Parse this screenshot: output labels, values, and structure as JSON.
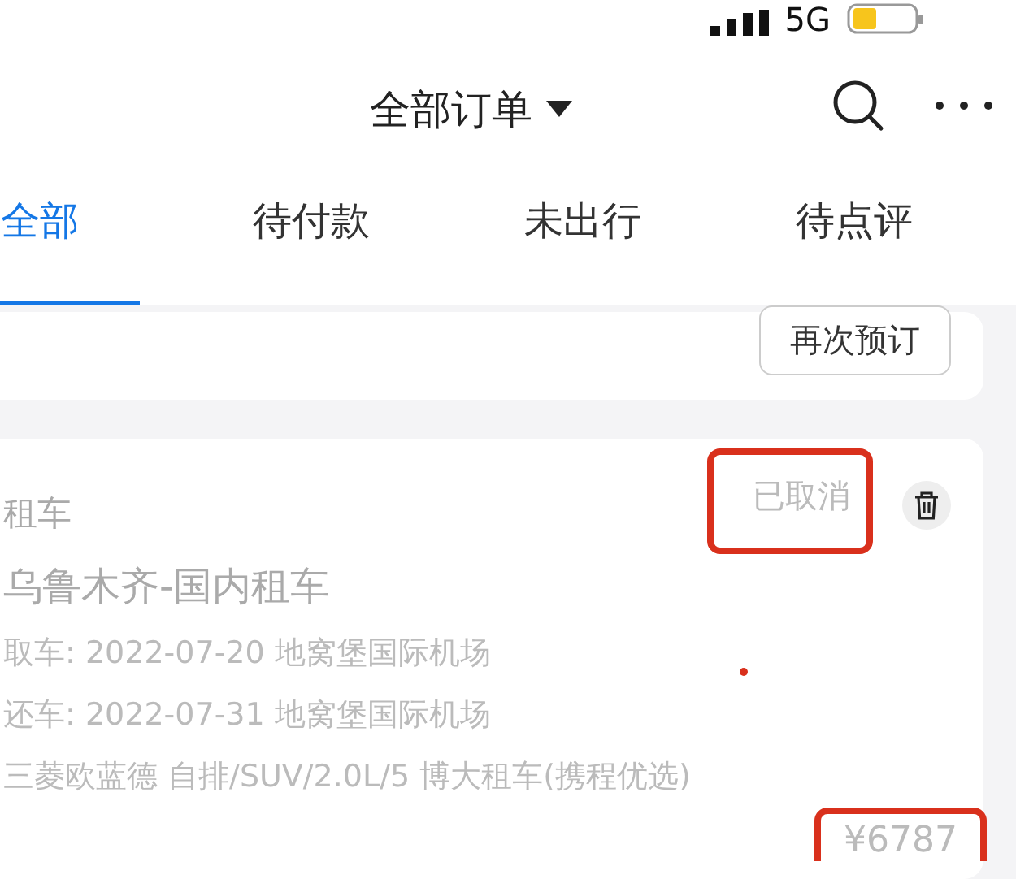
{
  "status_bar": {
    "network": "5G"
  },
  "header": {
    "title": "全部订单"
  },
  "tabs": [
    {
      "label": "全部",
      "selected": true
    },
    {
      "label": "待付款",
      "selected": false
    },
    {
      "label": "未出行",
      "selected": false
    },
    {
      "label": "待点评",
      "selected": false
    }
  ],
  "orders": [
    {
      "kind": "partial",
      "button": "再次预订"
    },
    {
      "kind": "full",
      "category": "租车",
      "status": "已取消",
      "status_highlighted": true,
      "disabled": true,
      "title": "乌鲁木齐-国内租车",
      "lines": [
        "取车: 2022-07-20 地窝堡国际机场",
        "还车: 2022-07-31 地窝堡国际机场",
        "三菱欧蓝德 自排/SUV/2.0L/5 博大租车(携程优选)"
      ],
      "price": "¥6787",
      "price_highlighted": true,
      "marker_dot": true
    }
  ]
}
